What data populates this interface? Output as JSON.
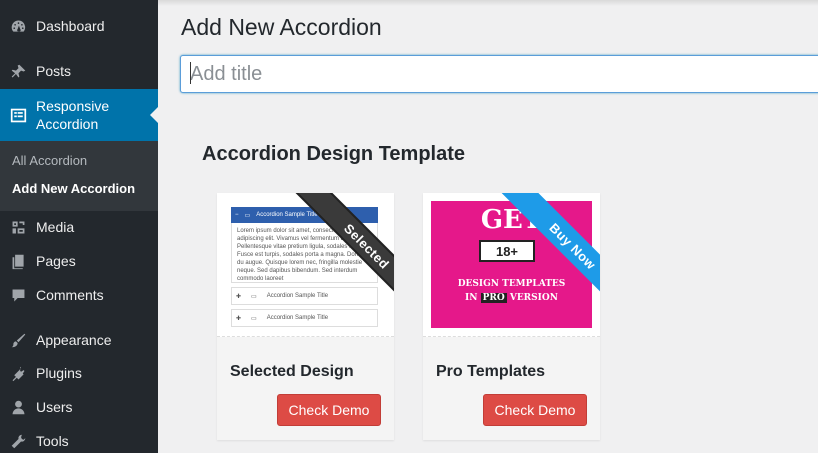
{
  "sidebar": {
    "items": [
      {
        "label": "Dashboard",
        "icon": "dashboard-icon"
      },
      {
        "label": "Posts",
        "icon": "pin-icon"
      },
      {
        "label": "Responsive Accordion",
        "icon": "accordion-icon"
      },
      {
        "label": "Media",
        "icon": "media-icon"
      },
      {
        "label": "Pages",
        "icon": "pages-icon"
      },
      {
        "label": "Comments",
        "icon": "comment-icon"
      },
      {
        "label": "Appearance",
        "icon": "brush-icon"
      },
      {
        "label": "Plugins",
        "icon": "plugin-icon"
      },
      {
        "label": "Users",
        "icon": "user-icon"
      },
      {
        "label": "Tools",
        "icon": "wrench-icon"
      }
    ],
    "responsive_line1": "Responsive",
    "responsive_line2": "Accordion",
    "submenu": [
      "All Accordion",
      "Add New Accordion"
    ]
  },
  "main": {
    "page_title": "Add New Accordion",
    "title_placeholder": "Add title",
    "section_title": "Accordion Design Template",
    "cards": [
      {
        "name": "Selected Design",
        "button": "Check Demo",
        "ribbon": "Selected",
        "preview": {
          "header": "Accordion Sample Title",
          "body": "Lorem ipsum dolor sit amet, consectetur adipiscing elit. Vivamus vel fermentum dui. Pellentesque vitae pretium ligula, sodales magna. Fusce est turpis, sodales porta a magna. Donec du augue. Quisque lorem nec, fringilla molestie neque. Sed dapibus bibendum. Sed interdum commodo laoreet",
          "rows": [
            "Accordion Sample Title",
            "Accordion Sample Title"
          ]
        }
      },
      {
        "name": "Pro Templates",
        "button": "Check Demo",
        "ribbon": "Buy Now",
        "promo": {
          "get": "GET",
          "badge": "18+",
          "line1": "DESIGN TEMPLATES",
          "line2_a": "IN",
          "line2_pro": "PRO",
          "line2_b": "VERSION"
        }
      }
    ]
  },
  "colors": {
    "sidebar_bg": "#23282d",
    "active_bg": "#0073aa",
    "button_red": "#dd4b45",
    "ribbon_blue": "#1e9be8",
    "promo_pink": "#e5188a"
  }
}
